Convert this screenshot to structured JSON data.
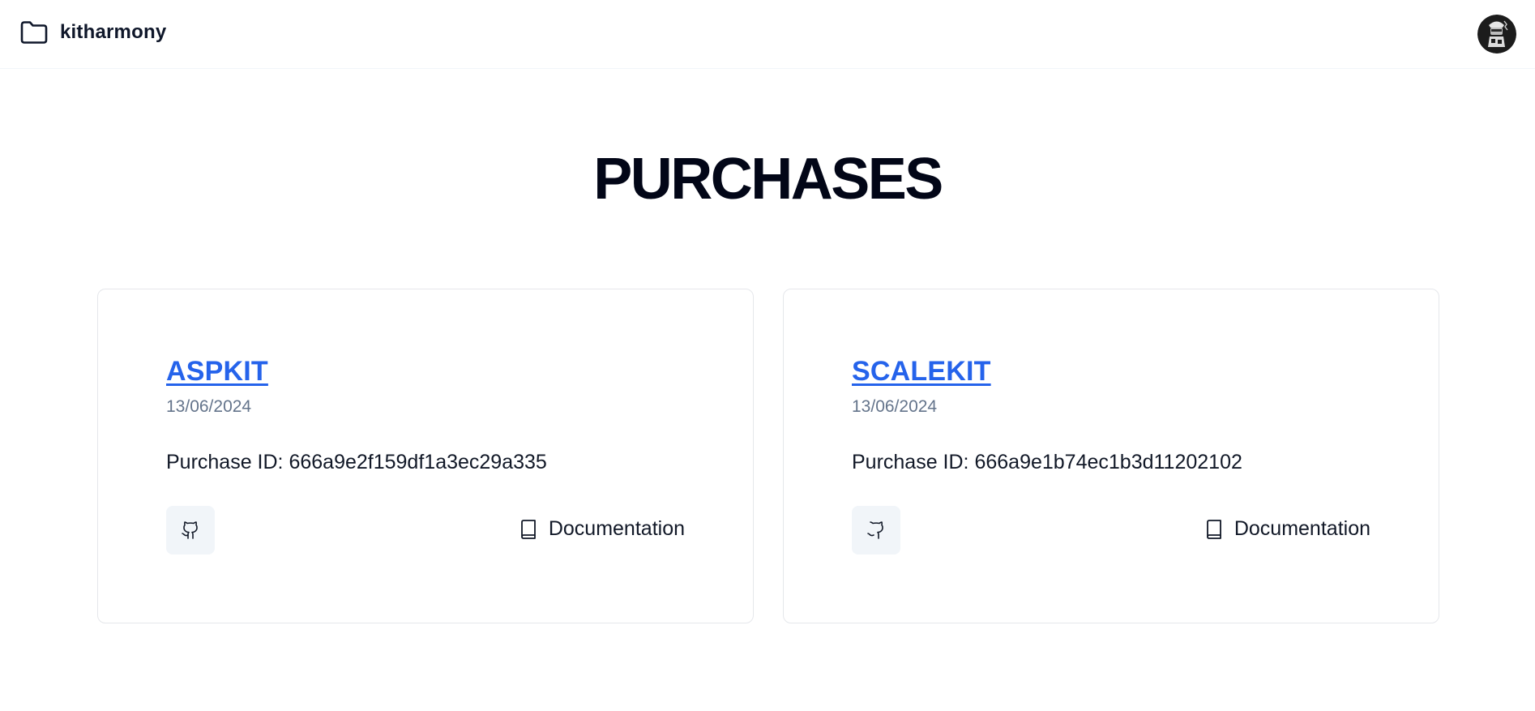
{
  "header": {
    "app_name": "kitharmony",
    "logo_icon": "folder-icon",
    "avatar_icon": "user-avatar"
  },
  "page": {
    "title": "PURCHASES"
  },
  "purchases": [
    {
      "name": "ASPKIT",
      "date": "13/06/2024",
      "purchase_id": "Purchase ID: 666a9e2f159df1a3ec29a335",
      "github_icon": "github-icon",
      "doc_icon": "book-icon",
      "doc_label": "Documentation"
    },
    {
      "name": "SCALEKIT",
      "date": "13/06/2024",
      "purchase_id": "Purchase ID: 666a9e1b74ec1b3d11202102",
      "github_icon": "github-icon",
      "doc_icon": "book-icon",
      "doc_label": "Documentation"
    }
  ],
  "colors": {
    "link": "#2563eb",
    "title": "#020617",
    "muted": "#64748b",
    "button_bg": "#f1f5f9",
    "border": "#e5e7eb"
  }
}
